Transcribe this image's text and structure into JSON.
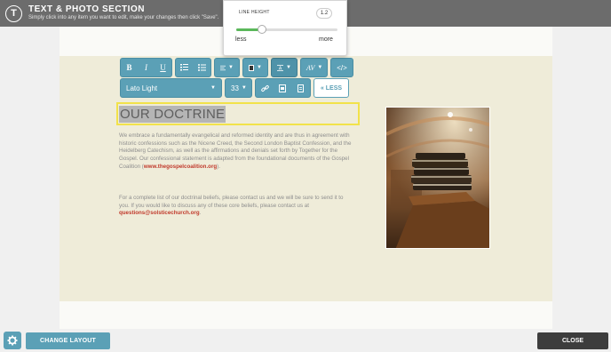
{
  "header": {
    "title": "TEXT & PHOTO SECTION",
    "subtitle": "Simply click into any item you want to edit, make your changes then click \"Save\".",
    "logo_letter": "T"
  },
  "line_height": {
    "label": "LINE HEIGHT",
    "value": "1.2",
    "min_label": "less",
    "max_label": "more",
    "level": 0.25
  },
  "toolbar": {
    "bold": "B",
    "italic": "I",
    "underline": "U",
    "font_family": "Lato Light",
    "font_size": "33",
    "less_label": "« LESS",
    "code_icon": "</>"
  },
  "content": {
    "heading": "OUR DOCTRINE",
    "para1": "We embrace a fundamentally evangelical and reformed identity and are thus in agreement with historic confessions such as the Nicene Creed, the Second London Baptist Confession, and the Heidelberg Catechism, as well as the affirmations and denials set forth by Together for the Gospel. Our confessional statement is adapted from the foundational documents of the Gospel Coalition (",
    "link1": "www.thegospelcoalition.org",
    "para1_end": ").",
    "para2": "For a complete list of our doctrinal beliefs, please contact us and we will be sure to send it to you. If you would like to discuss any of these core beliefs, please contact us at ",
    "email": "questions@solsticechurch.org",
    "para2_end": "."
  },
  "footer": {
    "change_layout": "CHANGE LAYOUT",
    "close": "CLOSE"
  },
  "colors": {
    "accent": "#5ba0b6",
    "link": "#c0392b",
    "band": "#efecd9",
    "highlight": "#f2e24a"
  }
}
